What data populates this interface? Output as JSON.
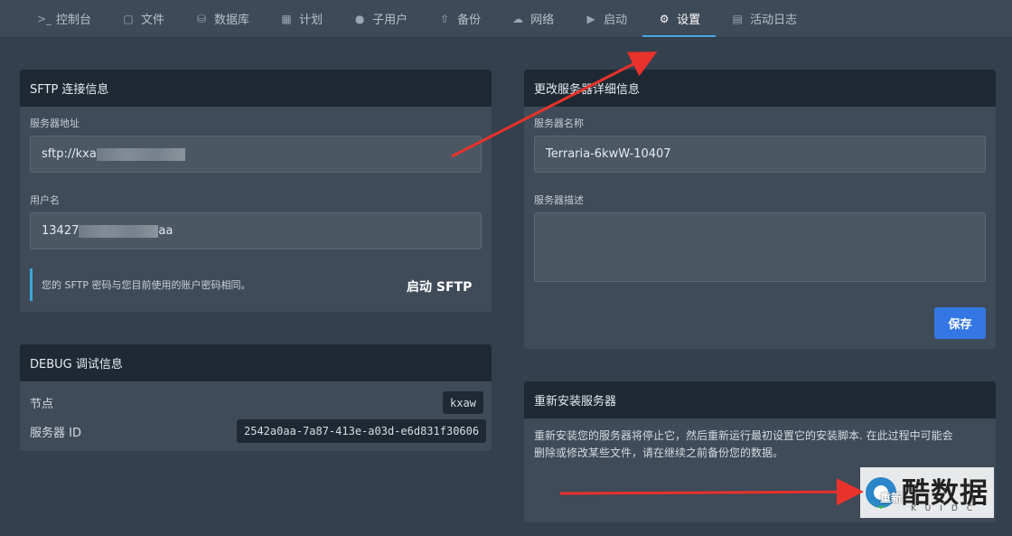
{
  "nav": {
    "tabs": [
      {
        "label": "控制台",
        "icon": "terminal-icon"
      },
      {
        "label": "文件",
        "icon": "folder-icon"
      },
      {
        "label": "数据库",
        "icon": "database-icon"
      },
      {
        "label": "计划",
        "icon": "calendar-icon"
      },
      {
        "label": "子用户",
        "icon": "users-icon"
      },
      {
        "label": "备份",
        "icon": "upload-icon"
      },
      {
        "label": "网络",
        "icon": "network-icon"
      },
      {
        "label": "启动",
        "icon": "play-icon"
      },
      {
        "label": "设置",
        "icon": "gears-icon",
        "active": true
      },
      {
        "label": "活动日志",
        "icon": "log-icon"
      }
    ]
  },
  "sftp": {
    "title": "SFTP 连接信息",
    "address_label": "服务器地址",
    "address_value": "sftp://kxa",
    "username_label": "用户名",
    "username_prefix": "13427",
    "username_suffix": "aa",
    "note": "您的 SFTP 密码与您目前使用的账户密码相同。",
    "launch_label": "启动 SFTP"
  },
  "debug": {
    "title": "DEBUG 调试信息",
    "node_label": "节点",
    "node_value": "kxaw",
    "server_id_label": "服务器 ID",
    "server_id_value": "2542a0aa-7a87-413e-a03d-e6d831f30606"
  },
  "details": {
    "title": "更改服务器详细信息",
    "name_label": "服务器名称",
    "name_value": "Terraria-6kwW-10407",
    "desc_label": "服务器描述",
    "desc_value": "",
    "save_label": "保存"
  },
  "reinstall": {
    "title": "重新安装服务器",
    "line1": "重新安装您的服务器将停止它，然后重新运行最初设置它的安装脚本. 在此过程中可能会",
    "line2": "删除或修改某些文件，请在继续之前备份您的数据。",
    "button_partial": "重新"
  },
  "watermark": {
    "text": "酷数据",
    "sub": "KUIDC"
  },
  "colors": {
    "accent": "#4aa8e0",
    "primary_button": "#3477e4",
    "arrow": "#e8322b"
  }
}
